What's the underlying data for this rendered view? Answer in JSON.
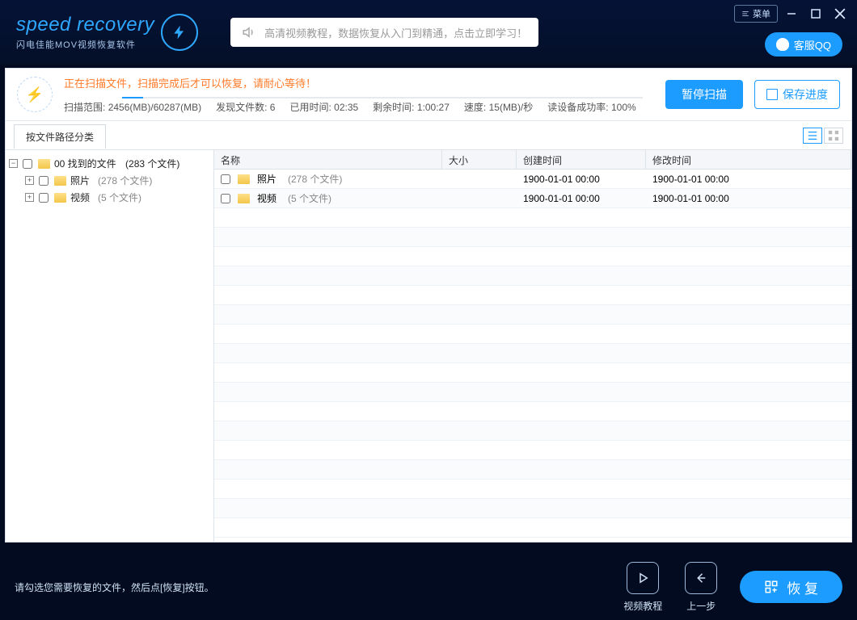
{
  "brand": {
    "main": "speed recovery",
    "sub": "闪电佳能MOV视频恢复软件"
  },
  "topbar": {
    "promo": "高清视频教程，数据恢复从入门到精通，点击立即学习！",
    "menuLabel": "菜单",
    "qqLabel": "客服QQ"
  },
  "scan": {
    "msg": "正在扫描文件，扫描完成后才可以恢复，请耐心等待！",
    "rangeLabel": "扫描范围:",
    "rangeValue": "2456(MB)/60287(MB)",
    "foundLabel": "发现文件数:",
    "foundValue": "6",
    "elapsedLabel": "已用时间:",
    "elapsedValue": "02:35",
    "remainLabel": "剩余时间:",
    "remainValue": "1:00:27",
    "speedLabel": "速度:",
    "speedValue": "15(MB)/秒",
    "successLabel": "读设备成功率:",
    "successValue": "100%",
    "pauseBtn": "暂停扫描",
    "saveBtn": "保存进度"
  },
  "tabs": {
    "byPath": "按文件路径分类"
  },
  "tree": {
    "root": "00 找到的文件",
    "rootCount": "(283 个文件)",
    "node1": "照片",
    "node1Count": "(278 个文件)",
    "node2": "视频",
    "node2Count": "(5 个文件)"
  },
  "columns": {
    "name": "名称",
    "size": "大小",
    "ctime": "创建时间",
    "mtime": "修改时间"
  },
  "rows": [
    {
      "name": "照片",
      "count": "(278 个文件)",
      "size": "",
      "ctime": "1900-01-01  00:00",
      "mtime": "1900-01-01  00:00"
    },
    {
      "name": "视频",
      "count": "(5 个文件)",
      "size": "",
      "ctime": "1900-01-01  00:00",
      "mtime": "1900-01-01  00:00"
    }
  ],
  "footer": {
    "hint": "请勾选您需要恢复的文件，然后点[恢复]按钮。",
    "tutorial": "视频教程",
    "back": "上一步",
    "recover": "恢 复"
  }
}
